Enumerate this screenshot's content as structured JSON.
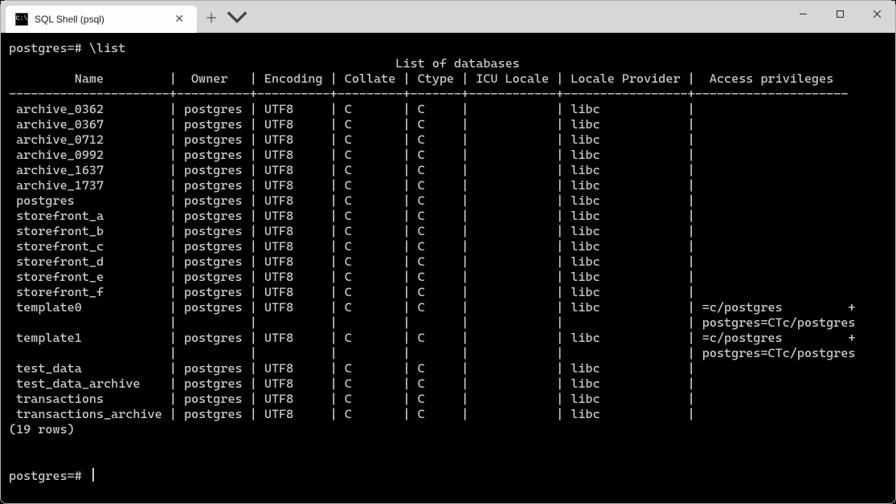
{
  "window": {
    "tab_title": "SQL Shell (psql)"
  },
  "prompt": {
    "prefix": "postgres=#",
    "command": "\\list"
  },
  "table": {
    "title": "List of databases",
    "columns": [
      "Name",
      "Owner",
      "Encoding",
      "Collate",
      "Ctype",
      "ICU Locale",
      "Locale Provider",
      "Access privileges"
    ],
    "rows": [
      {
        "name": "archive_0362",
        "owner": "postgres",
        "encoding": "UTF8",
        "collate": "C",
        "ctype": "C",
        "icu": "",
        "provider": "libc",
        "priv": [
          ""
        ]
      },
      {
        "name": "archive_0367",
        "owner": "postgres",
        "encoding": "UTF8",
        "collate": "C",
        "ctype": "C",
        "icu": "",
        "provider": "libc",
        "priv": [
          ""
        ]
      },
      {
        "name": "archive_0712",
        "owner": "postgres",
        "encoding": "UTF8",
        "collate": "C",
        "ctype": "C",
        "icu": "",
        "provider": "libc",
        "priv": [
          ""
        ]
      },
      {
        "name": "archive_0992",
        "owner": "postgres",
        "encoding": "UTF8",
        "collate": "C",
        "ctype": "C",
        "icu": "",
        "provider": "libc",
        "priv": [
          ""
        ]
      },
      {
        "name": "archive_1637",
        "owner": "postgres",
        "encoding": "UTF8",
        "collate": "C",
        "ctype": "C",
        "icu": "",
        "provider": "libc",
        "priv": [
          ""
        ]
      },
      {
        "name": "archive_1737",
        "owner": "postgres",
        "encoding": "UTF8",
        "collate": "C",
        "ctype": "C",
        "icu": "",
        "provider": "libc",
        "priv": [
          ""
        ]
      },
      {
        "name": "postgres",
        "owner": "postgres",
        "encoding": "UTF8",
        "collate": "C",
        "ctype": "C",
        "icu": "",
        "provider": "libc",
        "priv": [
          ""
        ]
      },
      {
        "name": "storefront_a",
        "owner": "postgres",
        "encoding": "UTF8",
        "collate": "C",
        "ctype": "C",
        "icu": "",
        "provider": "libc",
        "priv": [
          ""
        ]
      },
      {
        "name": "storefront_b",
        "owner": "postgres",
        "encoding": "UTF8",
        "collate": "C",
        "ctype": "C",
        "icu": "",
        "provider": "libc",
        "priv": [
          ""
        ]
      },
      {
        "name": "storefront_c",
        "owner": "postgres",
        "encoding": "UTF8",
        "collate": "C",
        "ctype": "C",
        "icu": "",
        "provider": "libc",
        "priv": [
          ""
        ]
      },
      {
        "name": "storefront_d",
        "owner": "postgres",
        "encoding": "UTF8",
        "collate": "C",
        "ctype": "C",
        "icu": "",
        "provider": "libc",
        "priv": [
          ""
        ]
      },
      {
        "name": "storefront_e",
        "owner": "postgres",
        "encoding": "UTF8",
        "collate": "C",
        "ctype": "C",
        "icu": "",
        "provider": "libc",
        "priv": [
          ""
        ]
      },
      {
        "name": "storefront_f",
        "owner": "postgres",
        "encoding": "UTF8",
        "collate": "C",
        "ctype": "C",
        "icu": "",
        "provider": "libc",
        "priv": [
          ""
        ]
      },
      {
        "name": "template0",
        "owner": "postgres",
        "encoding": "UTF8",
        "collate": "C",
        "ctype": "C",
        "icu": "",
        "provider": "libc",
        "priv": [
          "=c/postgres",
          "postgres=CTc/postgres"
        ]
      },
      {
        "name": "template1",
        "owner": "postgres",
        "encoding": "UTF8",
        "collate": "C",
        "ctype": "C",
        "icu": "",
        "provider": "libc",
        "priv": [
          "=c/postgres",
          "postgres=CTc/postgres"
        ]
      },
      {
        "name": "test_data",
        "owner": "postgres",
        "encoding": "UTF8",
        "collate": "C",
        "ctype": "C",
        "icu": "",
        "provider": "libc",
        "priv": [
          ""
        ]
      },
      {
        "name": "test_data_archive",
        "owner": "postgres",
        "encoding": "UTF8",
        "collate": "C",
        "ctype": "C",
        "icu": "",
        "provider": "libc",
        "priv": [
          ""
        ]
      },
      {
        "name": "transactions",
        "owner": "postgres",
        "encoding": "UTF8",
        "collate": "C",
        "ctype": "C",
        "icu": "",
        "provider": "libc",
        "priv": [
          ""
        ]
      },
      {
        "name": "transactions_archive",
        "owner": "postgres",
        "encoding": "UTF8",
        "collate": "C",
        "ctype": "C",
        "icu": "",
        "provider": "libc",
        "priv": [
          ""
        ]
      }
    ],
    "row_count_text": "(19 rows)"
  },
  "next_prompt": "postgres=#"
}
